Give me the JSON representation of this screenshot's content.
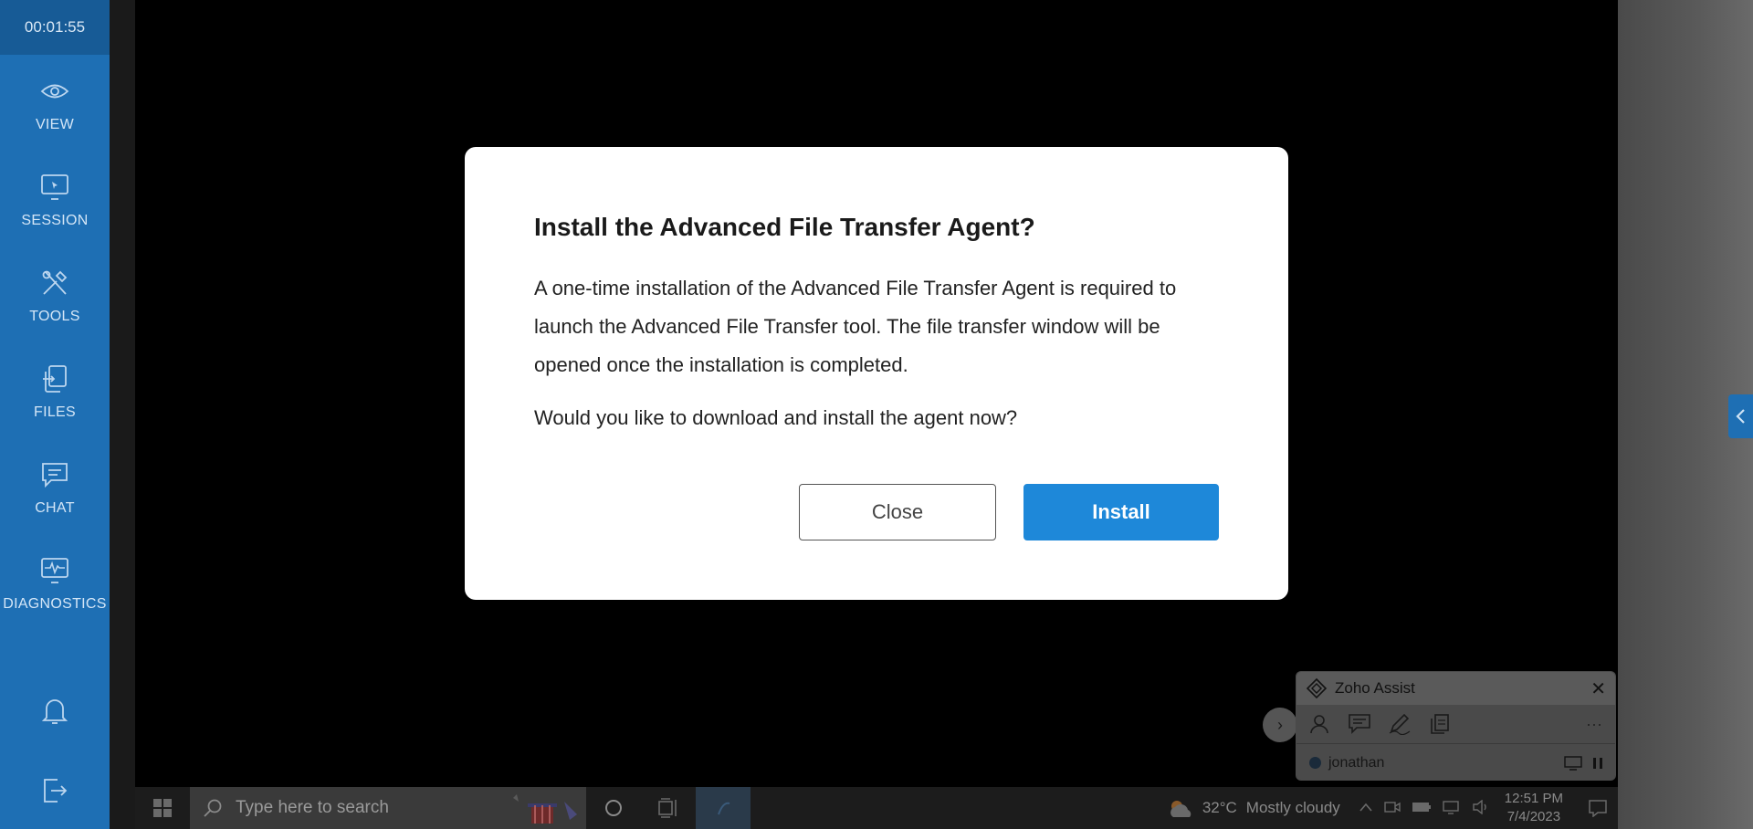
{
  "session": {
    "timer": "00:01:55"
  },
  "sidebar": {
    "items": [
      {
        "label": "VIEW",
        "icon": "eye-icon"
      },
      {
        "label": "SESSION",
        "icon": "monitor-icon"
      },
      {
        "label": "TOOLS",
        "icon": "tools-icon"
      },
      {
        "label": "FILES",
        "icon": "files-icon"
      },
      {
        "label": "CHAT",
        "icon": "chat-icon"
      },
      {
        "label": "DIAGNOSTICS",
        "icon": "diagnostics-icon"
      }
    ],
    "bottom_icons": [
      "bell-icon",
      "logout-icon"
    ]
  },
  "dialog": {
    "title": "Install the Advanced File Transfer Agent?",
    "body": "A one-time installation of the Advanced File Transfer Agent is required to launch the Advanced File Transfer tool. The file transfer window will be opened once the installation is completed.",
    "question": "Would you like to download and install the agent now?",
    "close_label": "Close",
    "install_label": "Install"
  },
  "zoho_widget": {
    "title": "Zoho Assist",
    "close_symbol": "✕",
    "user": "jonathan",
    "more_symbol": "···",
    "expand_symbol": "›"
  },
  "taskbar": {
    "search_placeholder": "Type here to search",
    "weather_temp": "32°C",
    "weather_desc": "Mostly cloudy",
    "time": "12:51 PM",
    "date": "7/4/2023"
  },
  "colors": {
    "sidebar": "#1e6fb4",
    "install_button": "#1e88d9"
  }
}
